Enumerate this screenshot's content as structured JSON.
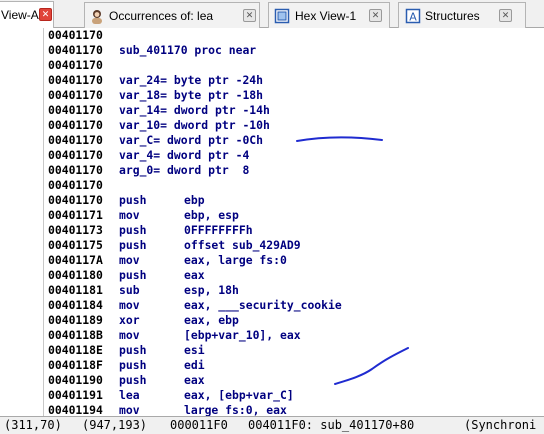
{
  "tabs": [
    {
      "label": "View-A",
      "icon": "document-icon",
      "active": true
    },
    {
      "label": "Occurrences of: lea",
      "icon": "person-icon",
      "active": false
    },
    {
      "label": "Hex View-1",
      "icon": "hex-view-icon",
      "active": false
    },
    {
      "label": "Structures",
      "icon": "structures-icon",
      "active": false
    }
  ],
  "listing": [
    {
      "addr": "00401170",
      "full": ""
    },
    {
      "addr": "00401170",
      "full": "sub_401170 proc near"
    },
    {
      "addr": "00401170",
      "full": ""
    },
    {
      "addr": "00401170",
      "full": "var_24= byte ptr -24h"
    },
    {
      "addr": "00401170",
      "full": "var_18= byte ptr -18h"
    },
    {
      "addr": "00401170",
      "full": "var_14= dword ptr -14h"
    },
    {
      "addr": "00401170",
      "full": "var_10= dword ptr -10h"
    },
    {
      "addr": "00401170",
      "full": "var_C= dword ptr -0Ch"
    },
    {
      "addr": "00401170",
      "full": "var_4= dword ptr -4"
    },
    {
      "addr": "00401170",
      "full": "arg_0= dword ptr  8"
    },
    {
      "addr": "00401170",
      "full": ""
    },
    {
      "addr": "00401170",
      "mn": "push",
      "ops": "ebp"
    },
    {
      "addr": "00401171",
      "mn": "mov",
      "ops": "ebp, esp"
    },
    {
      "addr": "00401173",
      "mn": "push",
      "ops": "0FFFFFFFFh"
    },
    {
      "addr": "00401175",
      "mn": "push",
      "ops": "offset sub_429AD9"
    },
    {
      "addr": "0040117A",
      "mn": "mov",
      "ops": "eax, large fs:0"
    },
    {
      "addr": "00401180",
      "mn": "push",
      "ops": "eax"
    },
    {
      "addr": "00401181",
      "mn": "sub",
      "ops": "esp, 18h"
    },
    {
      "addr": "00401184",
      "mn": "mov",
      "ops": "eax, ___security_cookie"
    },
    {
      "addr": "00401189",
      "mn": "xor",
      "ops": "eax, ebp"
    },
    {
      "addr": "0040118B",
      "mn": "mov",
      "ops": "[ebp+var_10], eax"
    },
    {
      "addr": "0040118E",
      "mn": "push",
      "ops": "esi"
    },
    {
      "addr": "0040118F",
      "mn": "push",
      "ops": "edi"
    },
    {
      "addr": "00401190",
      "mn": "push",
      "ops": "eax"
    },
    {
      "addr": "00401191",
      "mn": "lea",
      "ops": "eax, [ebp+var_C]"
    },
    {
      "addr": "00401194",
      "mn": "mov",
      "ops": "large fs:0, eax"
    }
  ],
  "status": {
    "cursor": "(311,70)",
    "mouse": "(947,193)",
    "offset": "000011F0",
    "location": "004011F0: sub_401170+80",
    "sync": "(Synchroni"
  }
}
